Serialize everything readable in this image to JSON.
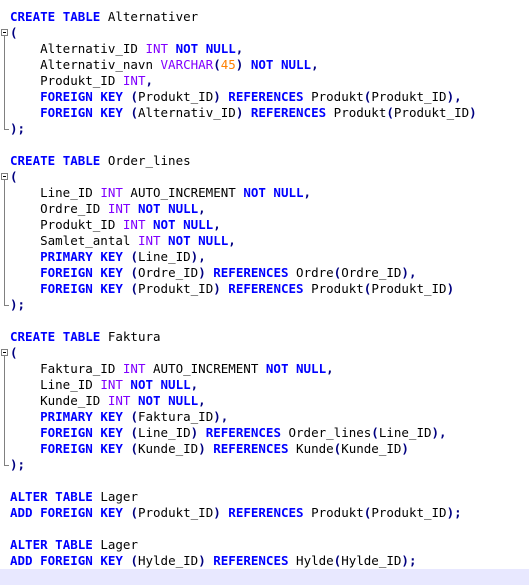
{
  "colors": {
    "keyword": "#0000ff",
    "type": "#8000ff",
    "number": "#ff8000",
    "operator": "#000080",
    "identifier": "#000000",
    "current_line": "#e8e8ff"
  },
  "editor": {
    "current_line": 35,
    "lines": [
      {
        "fold": "none",
        "tokens": [
          [
            "kw",
            "CREATE"
          ],
          [
            "id",
            " "
          ],
          [
            "kw",
            "TABLE"
          ],
          [
            "id",
            " Alternativer"
          ]
        ]
      },
      {
        "fold": "start",
        "tokens": [
          [
            "op",
            "("
          ]
        ]
      },
      {
        "fold": "mid",
        "tokens": [
          [
            "id",
            "    Alternativ_ID "
          ],
          [
            "ty",
            "INT"
          ],
          [
            "id",
            " "
          ],
          [
            "kw",
            "NOT"
          ],
          [
            "id",
            " "
          ],
          [
            "kw",
            "NULL"
          ],
          [
            "op",
            ","
          ]
        ]
      },
      {
        "fold": "mid",
        "tokens": [
          [
            "id",
            "    Alternativ_navn "
          ],
          [
            "ty",
            "VARCHAR"
          ],
          [
            "op",
            "("
          ],
          [
            "nu",
            "45"
          ],
          [
            "op",
            ")"
          ],
          [
            "id",
            " "
          ],
          [
            "kw",
            "NOT"
          ],
          [
            "id",
            " "
          ],
          [
            "kw",
            "NULL"
          ],
          [
            "op",
            ","
          ]
        ]
      },
      {
        "fold": "mid",
        "tokens": [
          [
            "id",
            "    Produkt_ID "
          ],
          [
            "ty",
            "INT"
          ],
          [
            "op",
            ","
          ]
        ]
      },
      {
        "fold": "mid",
        "tokens": [
          [
            "id",
            "    "
          ],
          [
            "kw",
            "FOREIGN"
          ],
          [
            "id",
            " "
          ],
          [
            "kw",
            "KEY"
          ],
          [
            "id",
            " "
          ],
          [
            "op",
            "("
          ],
          [
            "id",
            "Produkt_ID"
          ],
          [
            "op",
            ")"
          ],
          [
            "id",
            " "
          ],
          [
            "kw",
            "REFERENCES"
          ],
          [
            "id",
            " Produkt"
          ],
          [
            "op",
            "("
          ],
          [
            "id",
            "Produkt_ID"
          ],
          [
            "op",
            ")"
          ],
          [
            "op",
            ","
          ]
        ]
      },
      {
        "fold": "mid",
        "tokens": [
          [
            "id",
            "    "
          ],
          [
            "kw",
            "FOREIGN"
          ],
          [
            "id",
            " "
          ],
          [
            "kw",
            "KEY"
          ],
          [
            "id",
            " "
          ],
          [
            "op",
            "("
          ],
          [
            "id",
            "Alternativ_ID"
          ],
          [
            "op",
            ")"
          ],
          [
            "id",
            " "
          ],
          [
            "kw",
            "REFERENCES"
          ],
          [
            "id",
            " Produkt"
          ],
          [
            "op",
            "("
          ],
          [
            "id",
            "Produkt_ID"
          ],
          [
            "op",
            ")"
          ]
        ]
      },
      {
        "fold": "end",
        "tokens": [
          [
            "op",
            ")"
          ],
          [
            "op",
            ";"
          ]
        ]
      },
      {
        "fold": "none",
        "tokens": []
      },
      {
        "fold": "none",
        "tokens": [
          [
            "kw",
            "CREATE"
          ],
          [
            "id",
            " "
          ],
          [
            "kw",
            "TABLE"
          ],
          [
            "id",
            " Order_lines"
          ]
        ]
      },
      {
        "fold": "start",
        "tokens": [
          [
            "op",
            "("
          ]
        ]
      },
      {
        "fold": "mid",
        "tokens": [
          [
            "id",
            "    Line_ID "
          ],
          [
            "ty",
            "INT"
          ],
          [
            "id",
            " AUTO_INCREMENT "
          ],
          [
            "kw",
            "NOT"
          ],
          [
            "id",
            " "
          ],
          [
            "kw",
            "NULL"
          ],
          [
            "op",
            ","
          ]
        ]
      },
      {
        "fold": "mid",
        "tokens": [
          [
            "id",
            "    Ordre_ID "
          ],
          [
            "ty",
            "INT"
          ],
          [
            "id",
            " "
          ],
          [
            "kw",
            "NOT"
          ],
          [
            "id",
            " "
          ],
          [
            "kw",
            "NULL"
          ],
          [
            "op",
            ","
          ]
        ]
      },
      {
        "fold": "mid",
        "tokens": [
          [
            "id",
            "    Produkt_ID "
          ],
          [
            "ty",
            "INT"
          ],
          [
            "id",
            " "
          ],
          [
            "kw",
            "NOT"
          ],
          [
            "id",
            " "
          ],
          [
            "kw",
            "NULL"
          ],
          [
            "op",
            ","
          ]
        ]
      },
      {
        "fold": "mid",
        "tokens": [
          [
            "id",
            "    Samlet_antal "
          ],
          [
            "ty",
            "INT"
          ],
          [
            "id",
            " "
          ],
          [
            "kw",
            "NOT"
          ],
          [
            "id",
            " "
          ],
          [
            "kw",
            "NULL"
          ],
          [
            "op",
            ","
          ]
        ]
      },
      {
        "fold": "mid",
        "tokens": [
          [
            "id",
            "    "
          ],
          [
            "kw",
            "PRIMARY"
          ],
          [
            "id",
            " "
          ],
          [
            "kw",
            "KEY"
          ],
          [
            "id",
            " "
          ],
          [
            "op",
            "("
          ],
          [
            "id",
            "Line_ID"
          ],
          [
            "op",
            ")"
          ],
          [
            "op",
            ","
          ]
        ]
      },
      {
        "fold": "mid",
        "tokens": [
          [
            "id",
            "    "
          ],
          [
            "kw",
            "FOREIGN"
          ],
          [
            "id",
            " "
          ],
          [
            "kw",
            "KEY"
          ],
          [
            "id",
            " "
          ],
          [
            "op",
            "("
          ],
          [
            "id",
            "Ordre_ID"
          ],
          [
            "op",
            ")"
          ],
          [
            "id",
            " "
          ],
          [
            "kw",
            "REFERENCES"
          ],
          [
            "id",
            " Ordre"
          ],
          [
            "op",
            "("
          ],
          [
            "id",
            "Ordre_ID"
          ],
          [
            "op",
            ")"
          ],
          [
            "op",
            ","
          ]
        ]
      },
      {
        "fold": "mid",
        "tokens": [
          [
            "id",
            "    "
          ],
          [
            "kw",
            "FOREIGN"
          ],
          [
            "id",
            " "
          ],
          [
            "kw",
            "KEY"
          ],
          [
            "id",
            " "
          ],
          [
            "op",
            "("
          ],
          [
            "id",
            "Produkt_ID"
          ],
          [
            "op",
            ")"
          ],
          [
            "id",
            " "
          ],
          [
            "kw",
            "REFERENCES"
          ],
          [
            "id",
            " Produkt"
          ],
          [
            "op",
            "("
          ],
          [
            "id",
            "Produkt_ID"
          ],
          [
            "op",
            ")"
          ]
        ]
      },
      {
        "fold": "end",
        "tokens": [
          [
            "op",
            ")"
          ],
          [
            "op",
            ";"
          ]
        ]
      },
      {
        "fold": "none",
        "tokens": []
      },
      {
        "fold": "none",
        "tokens": [
          [
            "kw",
            "CREATE"
          ],
          [
            "id",
            " "
          ],
          [
            "kw",
            "TABLE"
          ],
          [
            "id",
            " Faktura"
          ]
        ]
      },
      {
        "fold": "start",
        "tokens": [
          [
            "op",
            "("
          ]
        ]
      },
      {
        "fold": "mid",
        "tokens": [
          [
            "id",
            "    Faktura_ID "
          ],
          [
            "ty",
            "INT"
          ],
          [
            "id",
            " AUTO_INCREMENT "
          ],
          [
            "kw",
            "NOT"
          ],
          [
            "id",
            " "
          ],
          [
            "kw",
            "NULL"
          ],
          [
            "op",
            ","
          ]
        ]
      },
      {
        "fold": "mid",
        "tokens": [
          [
            "id",
            "    Line_ID "
          ],
          [
            "ty",
            "INT"
          ],
          [
            "id",
            " "
          ],
          [
            "kw",
            "NOT"
          ],
          [
            "id",
            " "
          ],
          [
            "kw",
            "NULL"
          ],
          [
            "op",
            ","
          ]
        ]
      },
      {
        "fold": "mid",
        "tokens": [
          [
            "id",
            "    Kunde_ID "
          ],
          [
            "ty",
            "INT"
          ],
          [
            "id",
            " "
          ],
          [
            "kw",
            "NOT"
          ],
          [
            "id",
            " "
          ],
          [
            "kw",
            "NULL"
          ],
          [
            "op",
            ","
          ]
        ]
      },
      {
        "fold": "mid",
        "tokens": [
          [
            "id",
            "    "
          ],
          [
            "kw",
            "PRIMARY"
          ],
          [
            "id",
            " "
          ],
          [
            "kw",
            "KEY"
          ],
          [
            "id",
            " "
          ],
          [
            "op",
            "("
          ],
          [
            "id",
            "Faktura_ID"
          ],
          [
            "op",
            ")"
          ],
          [
            "op",
            ","
          ]
        ]
      },
      {
        "fold": "mid",
        "tokens": [
          [
            "id",
            "    "
          ],
          [
            "kw",
            "FOREIGN"
          ],
          [
            "id",
            " "
          ],
          [
            "kw",
            "KEY"
          ],
          [
            "id",
            " "
          ],
          [
            "op",
            "("
          ],
          [
            "id",
            "Line_ID"
          ],
          [
            "op",
            ")"
          ],
          [
            "id",
            " "
          ],
          [
            "kw",
            "REFERENCES"
          ],
          [
            "id",
            " Order_lines"
          ],
          [
            "op",
            "("
          ],
          [
            "id",
            "Line_ID"
          ],
          [
            "op",
            ")"
          ],
          [
            "op",
            ","
          ]
        ]
      },
      {
        "fold": "mid",
        "tokens": [
          [
            "id",
            "    "
          ],
          [
            "kw",
            "FOREIGN"
          ],
          [
            "id",
            " "
          ],
          [
            "kw",
            "KEY"
          ],
          [
            "id",
            " "
          ],
          [
            "op",
            "("
          ],
          [
            "id",
            "Kunde_ID"
          ],
          [
            "op",
            ")"
          ],
          [
            "id",
            " "
          ],
          [
            "kw",
            "REFERENCES"
          ],
          [
            "id",
            " Kunde"
          ],
          [
            "op",
            "("
          ],
          [
            "id",
            "Kunde_ID"
          ],
          [
            "op",
            ")"
          ]
        ]
      },
      {
        "fold": "end",
        "tokens": [
          [
            "op",
            ")"
          ],
          [
            "op",
            ";"
          ]
        ]
      },
      {
        "fold": "none",
        "tokens": []
      },
      {
        "fold": "none",
        "tokens": [
          [
            "kw",
            "ALTER"
          ],
          [
            "id",
            " "
          ],
          [
            "kw",
            "TABLE"
          ],
          [
            "id",
            " Lager"
          ]
        ]
      },
      {
        "fold": "none",
        "tokens": [
          [
            "kw",
            "ADD"
          ],
          [
            "id",
            " "
          ],
          [
            "kw",
            "FOREIGN"
          ],
          [
            "id",
            " "
          ],
          [
            "kw",
            "KEY"
          ],
          [
            "id",
            " "
          ],
          [
            "op",
            "("
          ],
          [
            "id",
            "Produkt_ID"
          ],
          [
            "op",
            ")"
          ],
          [
            "id",
            " "
          ],
          [
            "kw",
            "REFERENCES"
          ],
          [
            "id",
            " Produkt"
          ],
          [
            "op",
            "("
          ],
          [
            "id",
            "Produkt_ID"
          ],
          [
            "op",
            ")"
          ],
          [
            "op",
            ";"
          ]
        ]
      },
      {
        "fold": "none",
        "tokens": []
      },
      {
        "fold": "none",
        "tokens": [
          [
            "kw",
            "ALTER"
          ],
          [
            "id",
            " "
          ],
          [
            "kw",
            "TABLE"
          ],
          [
            "id",
            " Lager"
          ]
        ]
      },
      {
        "fold": "none",
        "tokens": [
          [
            "kw",
            "ADD"
          ],
          [
            "id",
            " "
          ],
          [
            "kw",
            "FOREIGN"
          ],
          [
            "id",
            " "
          ],
          [
            "kw",
            "KEY"
          ],
          [
            "id",
            " "
          ],
          [
            "op",
            "("
          ],
          [
            "id",
            "Hylde_ID"
          ],
          [
            "op",
            ")"
          ],
          [
            "id",
            " "
          ],
          [
            "kw",
            "REFERENCES"
          ],
          [
            "id",
            " Hylde"
          ],
          [
            "op",
            "("
          ],
          [
            "id",
            "Hylde_ID"
          ],
          [
            "op",
            ")"
          ],
          [
            "op",
            ";"
          ]
        ]
      },
      {
        "fold": "none",
        "tokens": []
      }
    ]
  }
}
